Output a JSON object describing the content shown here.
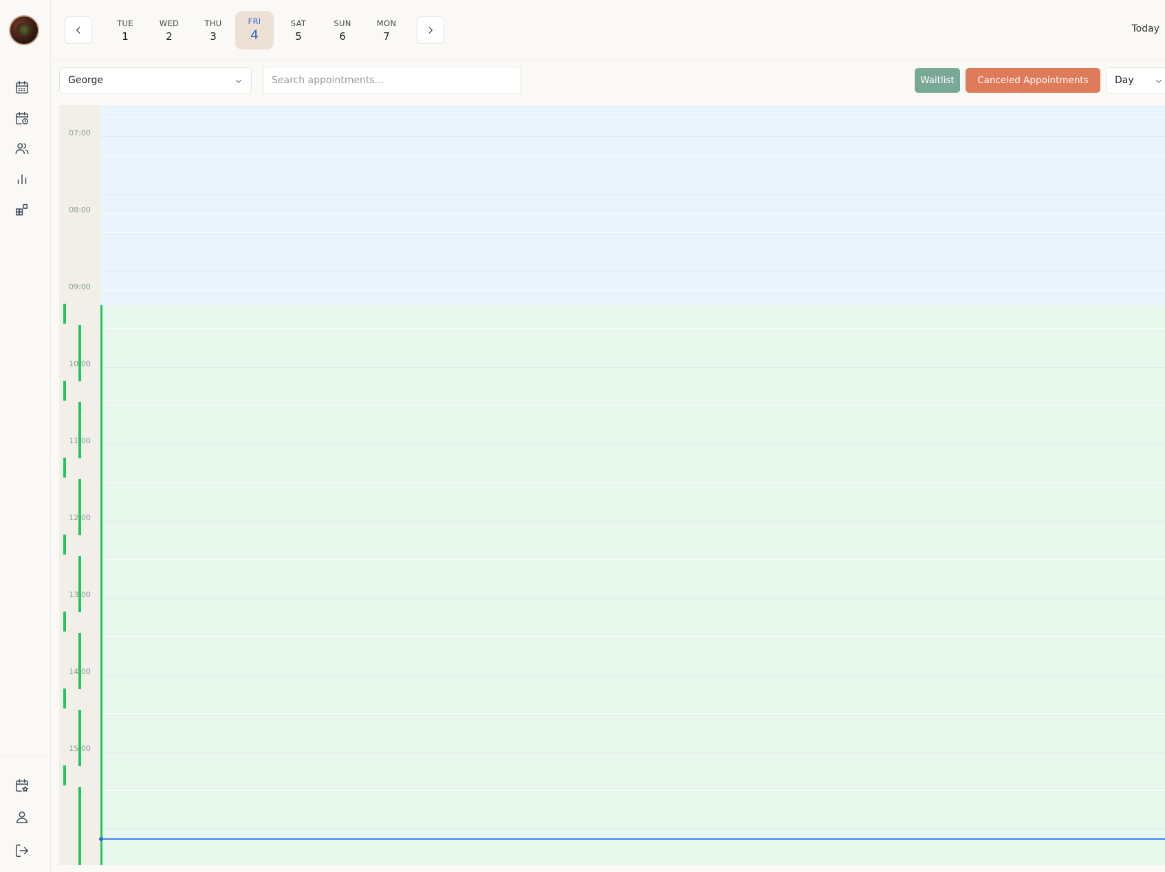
{
  "sidebar": {
    "icons": [
      "calendar-icon",
      "calendar-clock-icon",
      "users-icon",
      "bar-chart-icon",
      "widgets-icon",
      "calendar-star-icon",
      "user-icon",
      "logout-icon"
    ]
  },
  "week": {
    "days": [
      {
        "name": "TUE",
        "num": "1"
      },
      {
        "name": "WED",
        "num": "2"
      },
      {
        "name": "THU",
        "num": "3"
      },
      {
        "name": "FRI",
        "num": "4"
      },
      {
        "name": "SAT",
        "num": "5"
      },
      {
        "name": "SUN",
        "num": "6"
      },
      {
        "name": "MON",
        "num": "7"
      }
    ],
    "active_index": 3,
    "today_label": "Today"
  },
  "filters": {
    "staff_selected": "George",
    "search_placeholder": "Search appointments...",
    "waitlist_label": "Waitlist",
    "canceled_label": "Canceled Appointments",
    "view_selected": "Day"
  },
  "calendar": {
    "hours": [
      "07:00",
      "08:00",
      "09:00",
      "10:00",
      "11:00",
      "12:00",
      "13:00",
      "14:00",
      "15:00"
    ],
    "available_from": "09:00",
    "colors": {
      "unavailable": "#e9f4fc",
      "available": "#e8f8ec",
      "availability_marker": "#22c55e",
      "current_time": "#3b82f6"
    }
  },
  "colors": {
    "accent": "#2f66d6",
    "waitlist": "#7aa896",
    "canceled": "#e07b5a"
  }
}
